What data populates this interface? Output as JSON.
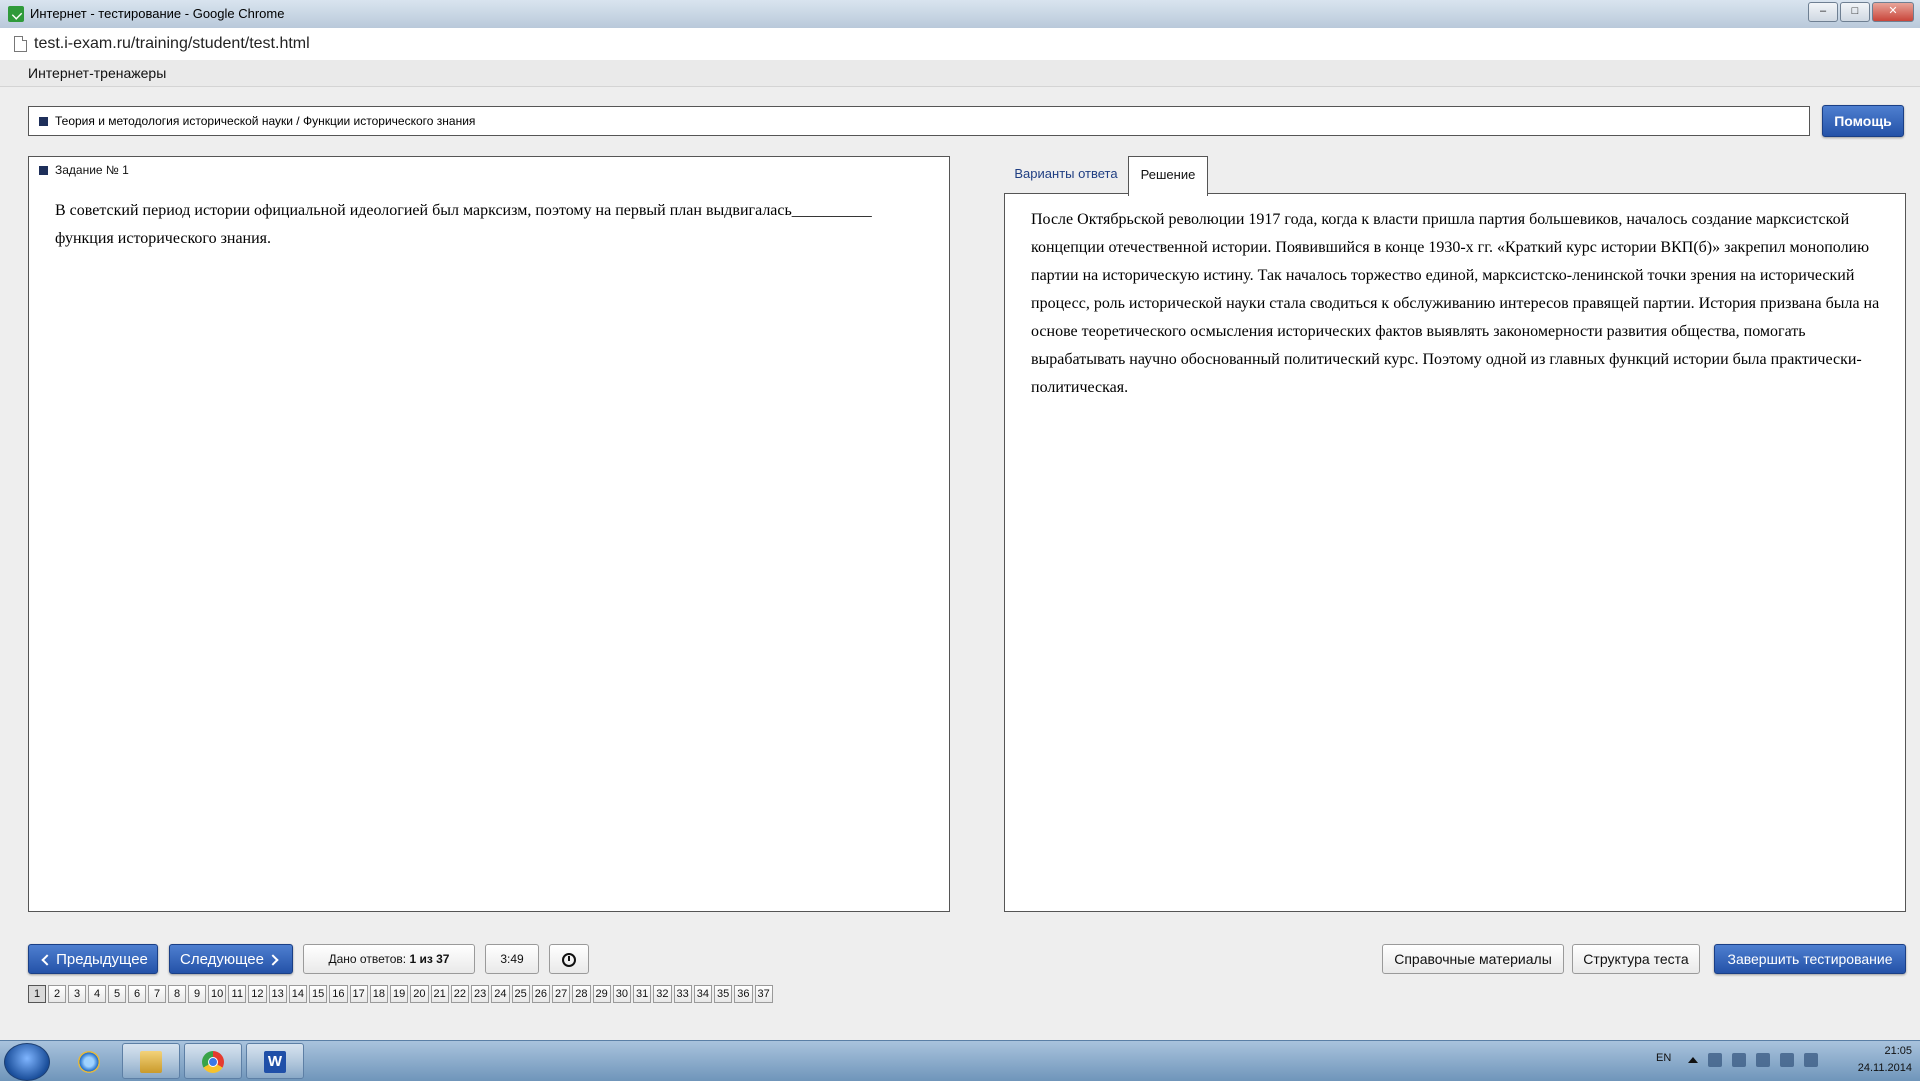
{
  "window": {
    "title": "Интернет - тестирование - Google Chrome",
    "controls": {
      "minimize": "–",
      "maximize": "□",
      "close": "✕"
    }
  },
  "browser": {
    "url": "test.i-exam.ru/training/student/test.html"
  },
  "app": {
    "name": "Интернет-тренажеры"
  },
  "breadcrumb": {
    "text": "Теория и методология исторической науки / Функции исторического знания"
  },
  "help_button": "Помощь",
  "task": {
    "title": "Задание № 1",
    "question": "В советский период истории официальной идеологией был марксизм, поэтому на первый план выдвигалась__________ функция исторического знания."
  },
  "tabs": [
    {
      "label": "Варианты ответа",
      "active": false
    },
    {
      "label": "Решение",
      "active": true
    }
  ],
  "solution": {
    "text": "После Октябрьской революции 1917 года, когда к власти пришла партия большевиков, началось создание марксистской концепции отечественной истории. Появившийся в конце 1930-х гг. «Краткий курс истории ВКП(б)» закрепил монополию партии на историческую истину. Так началось торжество единой, марксистско-ленинской точки зрения на исторический процесс, роль исторической науки стала сводиться к обслуживанию интересов правящей партии. История призвана была на основе теоретического осмысления исторических фактов выявлять закономерности развития общества, помогать вырабатывать научно обоснованный политический курс. Поэтому одной из главных функций истории была практически-политическая."
  },
  "footer": {
    "prev_label": "Предыдущее",
    "next_label": "Следующее",
    "answers_label": "Дано ответов:",
    "answers_value": "1 из 37",
    "timer": "3:49",
    "reference_label": "Справочные материалы",
    "structure_label": "Структура теста",
    "finish_label": "Завершить тестирование"
  },
  "pages": [
    "1",
    "2",
    "3",
    "4",
    "5",
    "6",
    "7",
    "8",
    "9",
    "10",
    "11",
    "12",
    "13",
    "14",
    "15",
    "16",
    "17",
    "18",
    "19",
    "20",
    "21",
    "22",
    "23",
    "24",
    "25",
    "26",
    "27",
    "28",
    "29",
    "30",
    "31",
    "32",
    "33",
    "34",
    "35",
    "36",
    "37"
  ],
  "current_page": "1",
  "taskbar": {
    "apps": [
      "windows-start-icon",
      "internet-explorer-icon",
      "file-explorer-icon",
      "chrome-icon",
      "word-icon"
    ],
    "word_glyph": "W",
    "language": "EN",
    "time": "21:05",
    "date": "24.11.2014"
  },
  "colors": {
    "accent": "#2452a8",
    "tab_text": "#1f3e82",
    "marker": "#1e2f5a"
  }
}
